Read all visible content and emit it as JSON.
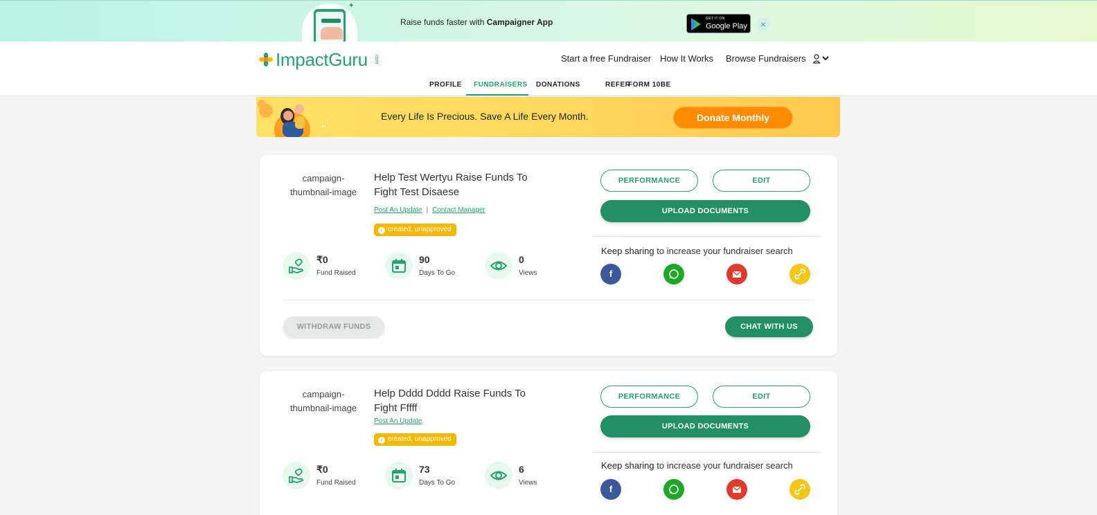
{
  "app_banner": {
    "text_prefix": "Raise funds faster with ",
    "text_bold": "Campaigner App",
    "store_small": "GET IT ON",
    "store_big": "Google Play",
    "close": "×"
  },
  "header": {
    "logo_text": "ImpactGuru",
    "logo_suffix": ".com",
    "nav": [
      "Start a free Fundraiser",
      "How It Works",
      "Browse Fundraisers"
    ],
    "tabs": [
      "PROFILE",
      "FUNDRAISERS",
      "DONATIONS",
      "REFER",
      "FORM 10BE"
    ],
    "active_tab": "FUNDRAISERS"
  },
  "promo": {
    "text": "Every Life Is Precious. Save A Life Every Month.",
    "button": "Donate Monthly"
  },
  "colors": {
    "brand": "#27a074",
    "brand_dark": "#238f66",
    "badge": "#f5b800",
    "donate": "#ff8c00"
  },
  "campaigns": [
    {
      "thumb_alt": "campaign-thumbnail-image",
      "title": "Help Test Wertyu Raise Funds To Fight Test Disaese",
      "link_update": "Post An Update",
      "link_separator": "|",
      "link_manager": "Contact Manager",
      "status": "created, unapproved",
      "raised": "₹0",
      "raised_label": "Fund Raised",
      "days": "90",
      "days_label": "Days To Go",
      "views": "0",
      "views_label": "Views",
      "btn_performance": "PERFORMANCE",
      "btn_edit": "EDIT",
      "btn_upload": "UPLOAD DOCUMENTS",
      "share_bold": "Keep sharing",
      "share_rest": " to increase your fundraiser search",
      "btn_withdraw": "WITHDRAW FUNDS",
      "btn_chat": "CHAT WITH US"
    },
    {
      "thumb_alt": "campaign-thumbnail-image",
      "title": "Help Dddd Dddd Raise Funds To Fight Fffff",
      "link_update": "Post An Update",
      "status": "created, unapproved",
      "raised": "₹0",
      "raised_label": "Fund Raised",
      "days": "73",
      "days_label": "Days To Go",
      "views": "6",
      "views_label": "Views",
      "btn_performance": "PERFORMANCE",
      "btn_edit": "EDIT",
      "btn_upload": "UPLOAD DOCUMENTS",
      "share_bold": "Keep sharing",
      "share_rest": " to increase your fundraiser search"
    }
  ]
}
